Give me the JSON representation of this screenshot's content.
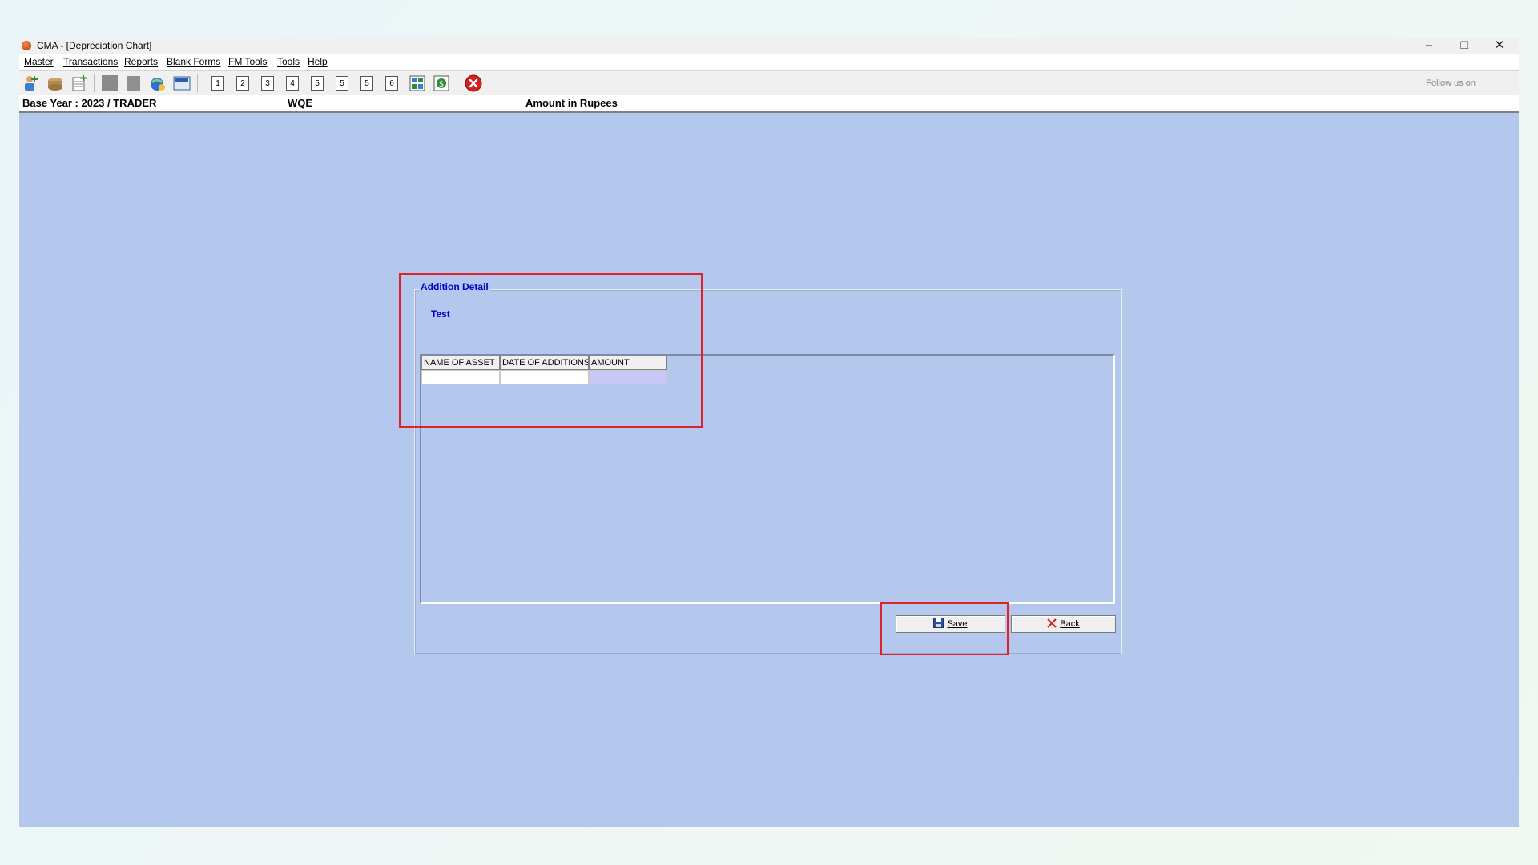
{
  "window": {
    "title": "CMA - [Depreciation Chart]",
    "controls": {
      "minimize": "–",
      "restore": "❐",
      "close": "✕"
    }
  },
  "menu": {
    "items": [
      "Master",
      "Transactions",
      "Reports",
      "Blank Forms",
      "FM Tools",
      "Tools",
      "Help"
    ]
  },
  "toolbar": {
    "number_buttons": [
      "1",
      "2",
      "3",
      "4",
      "5",
      "5",
      "5",
      "6"
    ],
    "follow_text": "Follow us on",
    "colors": {
      "close": "#d32020",
      "accent_green": "#2e8b3a"
    }
  },
  "infobar": {
    "base_year": "Base Year : 2023 / TRADER",
    "company": "WQE",
    "amount_unit": "Amount in Rupees"
  },
  "form": {
    "title": "Addition Detail",
    "subtitle": "Test",
    "columns": [
      "NAME OF ASSET",
      "DATE OF ADDITIONS",
      "AMOUNT"
    ],
    "rows": [
      [
        "",
        "",
        ""
      ]
    ],
    "save_label": "Save",
    "back_label": "Back"
  },
  "colors": {
    "workspace": "#b4c7ec",
    "label_blue": "#0000c8",
    "selected_cell": "#c8c8f8",
    "highlight": "#e0202a"
  }
}
